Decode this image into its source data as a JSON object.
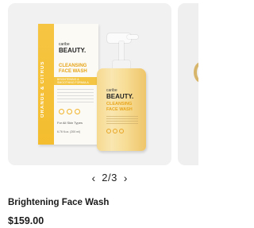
{
  "carousel": {
    "current": "2",
    "total": "3",
    "separator": "/",
    "prev_icon": "chevron-left-icon",
    "next_icon": "chevron-right-icon"
  },
  "product_image": {
    "box_brand_small": "caribe",
    "box_brand": "BEAUTY.",
    "box_name": "CLEANSING FACE WASH",
    "box_band": "BRIGHTENING & SMOOTHING FORMULA",
    "box_side": "ORANGE & CITRUS",
    "box_for": "For All Skin Types",
    "box_volume": "6.76 fl.oz. (200 ml)",
    "bottle_brand_small": "caribe",
    "bottle_brand": "BEAUTY.",
    "bottle_name": "CLEANSING FACE WASH",
    "accent_color": "#f4bd2f"
  },
  "product": {
    "title": "Brightening Face Wash",
    "price": "$159.00"
  }
}
